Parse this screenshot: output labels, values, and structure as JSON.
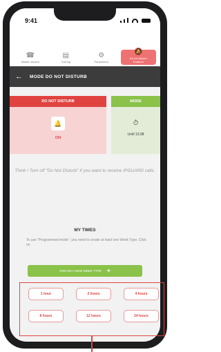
{
  "status_bar": {
    "time": "9:41"
  },
  "tabs": [
    {
      "label": "Mobile unused",
      "icon": "phone-icon"
    },
    {
      "label": "Call log",
      "icon": "calendar-icon"
    },
    {
      "label": "Parameters",
      "icon": "gear-icon"
    },
    {
      "label": "Do not disturb",
      "sublabel": "Enabled",
      "icon": "bell-off-icon",
      "active": true
    }
  ],
  "header": {
    "title": "MODE DO NOT DISTURB"
  },
  "dnd_card": {
    "title": "DO NOT DISTURB",
    "state": "ON"
  },
  "mode_card": {
    "title": "MODE",
    "until": "Until 13:38"
  },
  "info_text": "Think ! Turn off \"Do Not Disturb\" if you want to receive IPGUARD calls.",
  "my_times": {
    "title": "MY TIMES",
    "description": "To use \"Programmed mode\", you need to create at least one Week Type. Click on",
    "create_button": "CREATE A NEW WEEK TYPE"
  },
  "presets": [
    "1 hour",
    "2 hours",
    "4 hours",
    "8 hours",
    "12 hours",
    "24 hours"
  ],
  "colors": {
    "accent_red": "#e0433f",
    "accent_green": "#8ac24a",
    "header_dark": "#3c3c3c"
  }
}
